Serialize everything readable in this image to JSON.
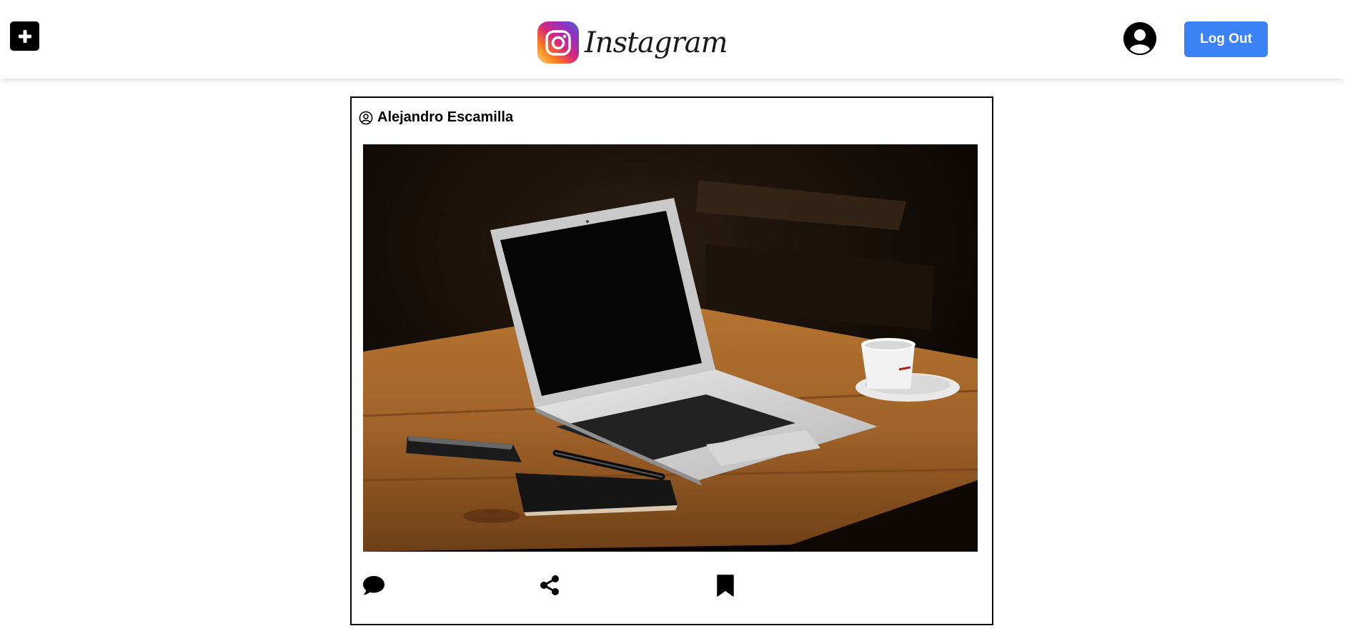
{
  "header": {
    "add_icon": "plus-square-icon",
    "logo_text": "Instagram",
    "logo_icon": "instagram-camera-icon",
    "avatar_icon": "user-circle-icon",
    "logout_label": "Log Out",
    "logout_color": "#3b82f6"
  },
  "post": {
    "username": "Alejandro Escamilla",
    "user_icon": "user-circle-outline-icon",
    "image_subject": "laptop-on-wooden-table",
    "actions": {
      "comment_icon": "comment-icon",
      "share_icon": "share-icon",
      "bookmark_icon": "bookmark-icon"
    }
  }
}
